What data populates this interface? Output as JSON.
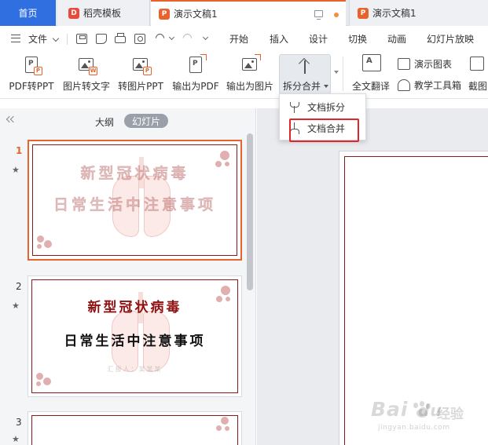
{
  "tabs": {
    "home": "首页",
    "docer": "稻壳模板",
    "active_doc": "演示文稿1",
    "other_doc": "演示文稿1"
  },
  "menu": {
    "file": "文件",
    "items": [
      "开始",
      "插入",
      "设计",
      "切换",
      "动画",
      "幻灯片放映"
    ]
  },
  "ribbon": {
    "pdf_to_ppt": "PDF转PPT",
    "image_to_text": "图片转文字",
    "to_image_ppt": "转图片PPT",
    "export_pdf": "输出为PDF",
    "export_image": "输出为图片",
    "split_merge": "拆分合并",
    "full_translate": "全文翻译",
    "show_chart": "演示图表",
    "teaching_tools": "教学工具箱",
    "screenshot_partial": "截图"
  },
  "dropdown": {
    "split": "文档拆分",
    "merge": "文档合并"
  },
  "panel": {
    "outline": "大纲",
    "slides": "幻灯片"
  },
  "slides": [
    {
      "number": "1",
      "title": "新型冠状病毒",
      "subtitle": "日常生活中注意事项"
    },
    {
      "number": "2",
      "title": "新型冠状病毒",
      "subtitle": "日常生活中注意事项",
      "footnote": "汇报人：某某某"
    },
    {
      "number": "3"
    }
  ],
  "watermark": {
    "brand": "Bai",
    "suffix": "du",
    "cn": "经验",
    "url": "jingyan.baidu.com"
  },
  "colors": {
    "accent": "#e8632b",
    "home_tab": "#2f6fe0",
    "highlight": "#e0262a",
    "slide_frame": "#8b1a1a"
  }
}
